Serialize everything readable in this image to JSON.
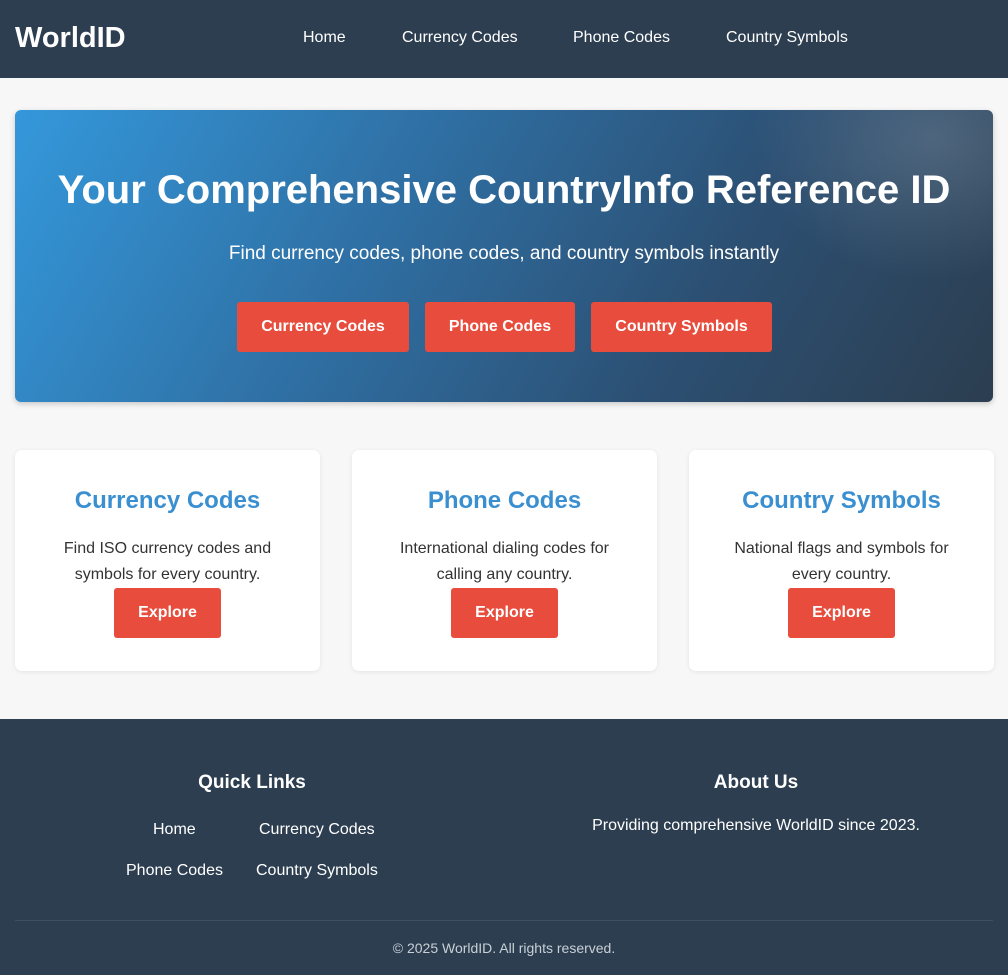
{
  "header": {
    "brand": "WorldID",
    "nav": [
      "Home",
      "Currency Codes",
      "Phone Codes",
      "Country Symbols"
    ]
  },
  "hero": {
    "title": "Your Comprehensive CountryInfo Reference ID",
    "subtitle": "Find currency codes, phone codes, and country symbols instantly",
    "buttons": [
      "Currency Codes",
      "Phone Codes",
      "Country Symbols"
    ]
  },
  "features": [
    {
      "title": "Currency Codes",
      "text": "Find ISO currency codes and symbols for every country.",
      "button": "Explore"
    },
    {
      "title": "Phone Codes",
      "text": "International dialing codes for calling any country.",
      "button": "Explore"
    },
    {
      "title": "Country Symbols",
      "text": "National flags and symbols for every country.",
      "button": "Explore"
    }
  ],
  "footer": {
    "quick_links_heading": "Quick Links",
    "quick_links": [
      "Home",
      "Currency Codes",
      "Phone Codes",
      "Country Symbols"
    ],
    "about_heading": "About Us",
    "about_text": "Providing comprehensive WorldID since 2023.",
    "copyright": "© 2025 WorldID. All rights reserved."
  },
  "colors": {
    "header_bg": "#2c3e50",
    "accent_red": "#e74c3c",
    "accent_blue": "#3498db",
    "page_bg": "#f7f7f7"
  }
}
